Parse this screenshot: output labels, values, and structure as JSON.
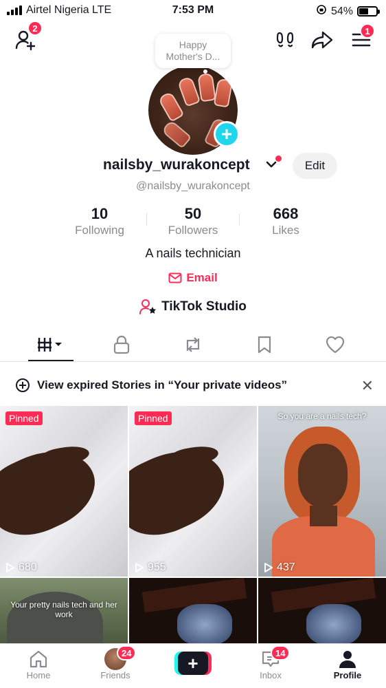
{
  "status_bar": {
    "carrier": "Airtel Nigeria  LTE",
    "time": "7:53 PM",
    "battery": "54%",
    "battery_level": 0.54
  },
  "top_bar": {
    "add_friend_badge": "2",
    "menu_badge": "1"
  },
  "profile": {
    "note_bubble": "Happy Mother's D...",
    "display_name": "nailsby_wurakoncept",
    "edit_label": "Edit",
    "handle": "@nailsby_wurakoncept",
    "bio": "A nails technician",
    "email_label": "Email",
    "studio_label": "TikTok Studio"
  },
  "stats": [
    {
      "value": "10",
      "label": "Following"
    },
    {
      "value": "50",
      "label": "Followers"
    },
    {
      "value": "668",
      "label": "Likes"
    }
  ],
  "notice": {
    "text": "View expired Stories in “Your private videos”"
  },
  "videos": [
    {
      "pinned": "Pinned",
      "views": "680"
    },
    {
      "pinned": "Pinned",
      "views": "955"
    },
    {
      "caption": "So you are a nails tech?",
      "views": "437"
    },
    {
      "caption": "Your pretty nails tech and her work"
    },
    {},
    {}
  ],
  "bottom_nav": {
    "home": "Home",
    "friends": "Friends",
    "friends_badge": "24",
    "inbox": "Inbox",
    "inbox_badge": "14",
    "profile": "Profile"
  },
  "colors": {
    "accent": "#fe2c55",
    "cyan": "#20d5ec",
    "text": "#161823",
    "muted": "#8a8b91"
  }
}
